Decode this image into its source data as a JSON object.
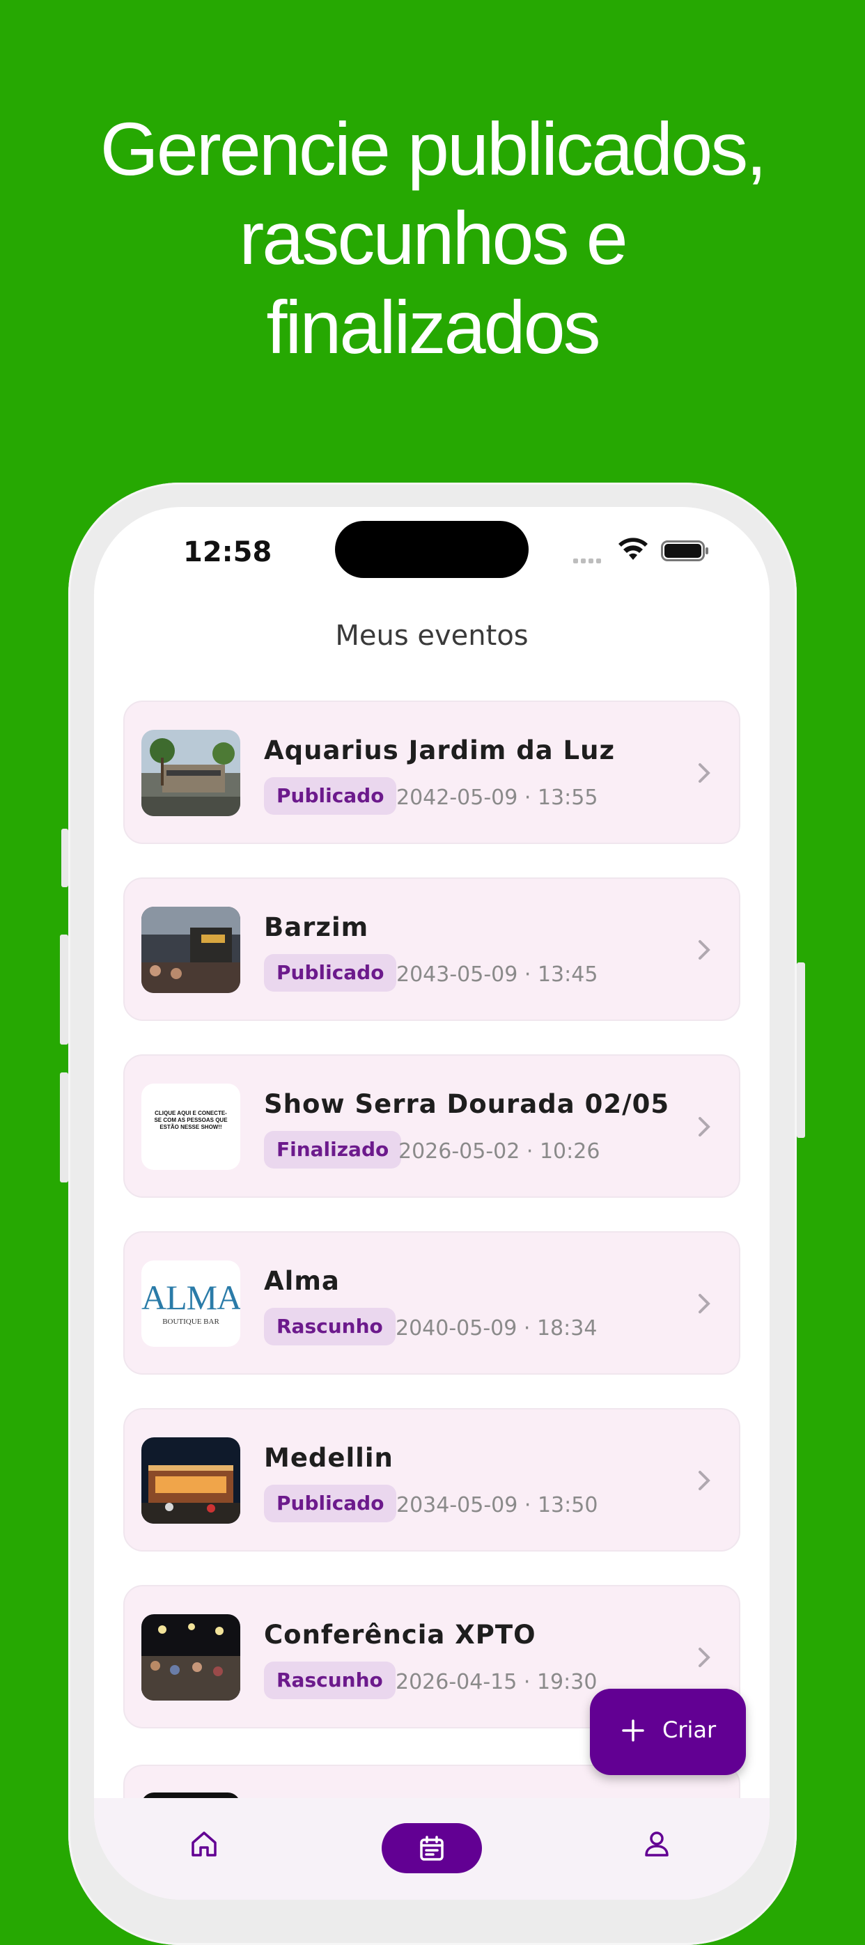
{
  "headline": [
    "Gerencie publicados,",
    "rascunhos e",
    "finalizados"
  ],
  "status_bar": {
    "time": "12:58"
  },
  "page": {
    "title": "Meus eventos"
  },
  "events": [
    {
      "name": "Aquarius Jardim da Luz",
      "status": "Publicado",
      "datetime": "2042-05-09 · 13:55"
    },
    {
      "name": "Barzim",
      "status": "Publicado",
      "datetime": "2043-05-09 · 13:45"
    },
    {
      "name": "Show Serra Dourada 02/05",
      "status": "Finalizado",
      "datetime": "2026-05-02 · 10:26",
      "thumb_text": "CLIQUE AQUI E CONECTE-SE COM AS PESSOAS QUE ESTÃO NESSE SHOW!!"
    },
    {
      "name": "Alma",
      "status": "Rascunho",
      "datetime": "2040-05-09 · 18:34",
      "thumb_logo": "ALMA",
      "thumb_sub": "BOUTIQUE BAR"
    },
    {
      "name": "Medellin",
      "status": "Publicado",
      "datetime": "2034-05-09 · 13:50"
    },
    {
      "name": "Conferência XPTO",
      "status": "Rascunho",
      "datetime": "2026-04-15 · 19:30"
    }
  ],
  "fab": {
    "label": "Criar",
    "icon": "plus-icon"
  },
  "bottom_nav": [
    {
      "icon": "home-icon",
      "active": false
    },
    {
      "icon": "calendar-icon",
      "active": true
    },
    {
      "icon": "profile-icon",
      "active": false
    }
  ],
  "colors": {
    "background": "#26a802",
    "accent": "#620093",
    "badge_bg": "#ead7ee",
    "card_bg": "#faeef6"
  }
}
